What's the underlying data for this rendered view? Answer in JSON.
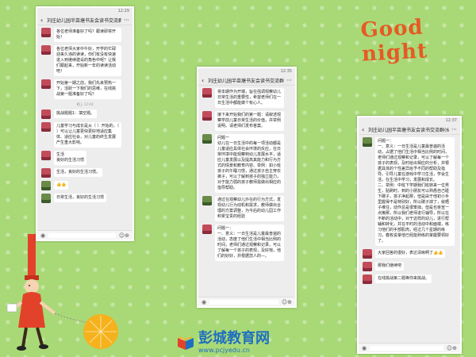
{
  "decor": {
    "greeting": "Good night"
  },
  "phones": [
    {
      "status_time": "12:29",
      "title": "刘庄幼儿园半亩塘书友会读书交流群(6)",
      "messages": [
        {
          "id": 1,
          "text": "各位老师准备好了吗？跟读即将开始！"
        },
        {
          "id": 2,
          "text": "各位老师大家中午好，开学的忙碌迎来久违的读读，你们有没有快速进入到继续建设的角色中呢？让我们跟起来，开始新一年的读读活动吧！"
        },
        {
          "id": 3,
          "text": "开始第一期之前，我们先来预热一下，活跃一下我们的思维，在线挑战第一题准备好了吗？"
        },
        {
          "id": 4,
          "text": "挑战题题1：填空题。"
        },
        {
          "id": 5,
          "text": "儿童学习与成长是从（ ）开始的，（ ）可以让儿童更快更好地适应集体、适应社会，对儿童的终生发展产生重大影响。"
        },
        {
          "id": 6,
          "text": "生活\n良好的生活习惯"
        },
        {
          "id": 7,
          "text": "生活，良好的生活习惯。"
        },
        {
          "id": 8,
          "text": "👍👍"
        },
        {
          "id": 9,
          "text": "日常生活，良好的生活习惯"
        }
      ],
      "timestamp": "晚上 12:44"
    },
    {
      "status_time": "12:35",
      "title": "刘庄幼儿园半亩塘书友会读书交流群(6)",
      "messages": [
        {
          "id": 1,
          "text": "将本期作为开端，旨在强调观察幼儿日常生活的重要性，希望老师们在一日生活中都能做个有心人。"
        },
        {
          "id": 2,
          "text": "接下来开始我们的第一题：请叙述观察学前儿童日常生活的价值，并举例说明。请老师们发布答案。"
        },
        {
          "id": 3,
          "text": "问题一\n幼儿在一日生活中的每一项活动都是儿童适应具体社会环境的反应，在日常环境中能观察到幼儿发展水平，适应儿童发展以及提高其能力和行为方式的情景和教育内容。举例：如小班孩子的午睡习惯，通过孩子自主穿衣裤子，可以了解到孩子的独立能力，对于能力弱的孩子教师需做出相应的指导帮助。"
        },
        {
          "id": 4,
          "text": "通过在观察幼儿外在的行为方式，发现幼儿行为动机和需求，教师做出合理的方案调整，为今后的幼儿园工作积累宝贵的经验"
        },
        {
          "id": 5,
          "text": "问题一：\n一、意义：一日生活是儿童最普遍的活动，态度了他们生活中相当比例的时间，老师们通过观察和记录，可以了解每一个孩子的表现，及好饱，他们的好好，并根据您人的—。"
        }
      ]
    },
    {
      "status_time": "12:37",
      "title": "刘庄幼儿园半亩塘书友会读书交流群(6)",
      "messages": [
        {
          "id": 1,
          "text": "问题一：\n一、意义：一日生活是儿童最普遍的活动，占据了他们生活中相当比例的时间，老师们通过观察和记录，可以了解每一个孩子的表现，及时给出相应的分析，并根据具体的个性差异给予不同的帮助及指导。引导儿童在游戏中学习生活，学会生活，在生活中学习，发展和成长。\n二、举例：中班下学期我们班转来一位男生，贴刷时，到的小朋友可以熟悉自己碰下碳子，孩子净起那，但是由于他初小手里握得不是特别好，所以碳子掉了，就晒子维住，动作总是很笨拙，但是也亲宣一点懒那，所以我们老师进行辅导，所以在不断的活动中，对于这样的幼儿，进行帮辅和转化，并在平时的活动中和面端，练习他们的手部肌肉，经过几个星期的练习，春枚说掌他已经能熟练的掌握要领好了。"
        },
        {
          "id": 2,
          "text": "大家回答的很好，表达清晰啊了👍👍"
        },
        {
          "id": 3,
          "text": "那我们继续吧"
        },
        {
          "id": 4,
          "text": "在线挑战第二题等你来挑战。"
        }
      ]
    }
  ],
  "footer": {
    "brand": "彭城教育网",
    "url": "www.pcjyedu.cn"
  }
}
